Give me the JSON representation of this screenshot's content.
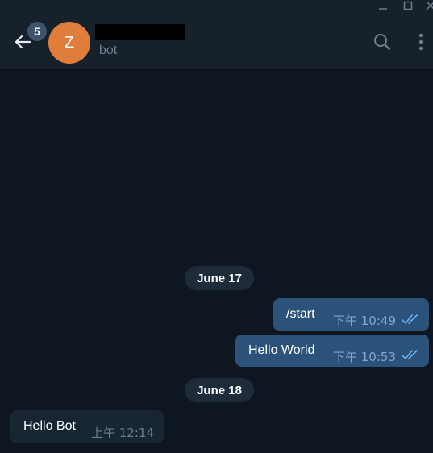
{
  "window": {
    "controls": [
      "minimize-icon",
      "maximize-icon",
      "close-icon"
    ]
  },
  "header": {
    "unread_badge": "5",
    "avatar_initial": "Z",
    "name_redacted": true,
    "status": "bot",
    "icons": [
      "back-arrow-icon",
      "search-icon",
      "more-vertical-icon"
    ],
    "avatar_color": "#e17d3b"
  },
  "chat": {
    "date_dividers": [
      "June 17",
      "June 18"
    ],
    "messages": [
      {
        "direction": "out",
        "text": "/start",
        "time": "下午 10:49",
        "status": "read"
      },
      {
        "direction": "out",
        "text": "Hello World",
        "time": "下午 10:53",
        "status": "read"
      },
      {
        "direction": "in",
        "text": "Hello Bot",
        "time": "上午 12:14"
      }
    ]
  },
  "colors": {
    "background": "#0e1621",
    "header": "#17212b",
    "outgoing_bubble": "#2b5278",
    "incoming_bubble": "#182533",
    "date_pill": "#1e2c3a"
  }
}
